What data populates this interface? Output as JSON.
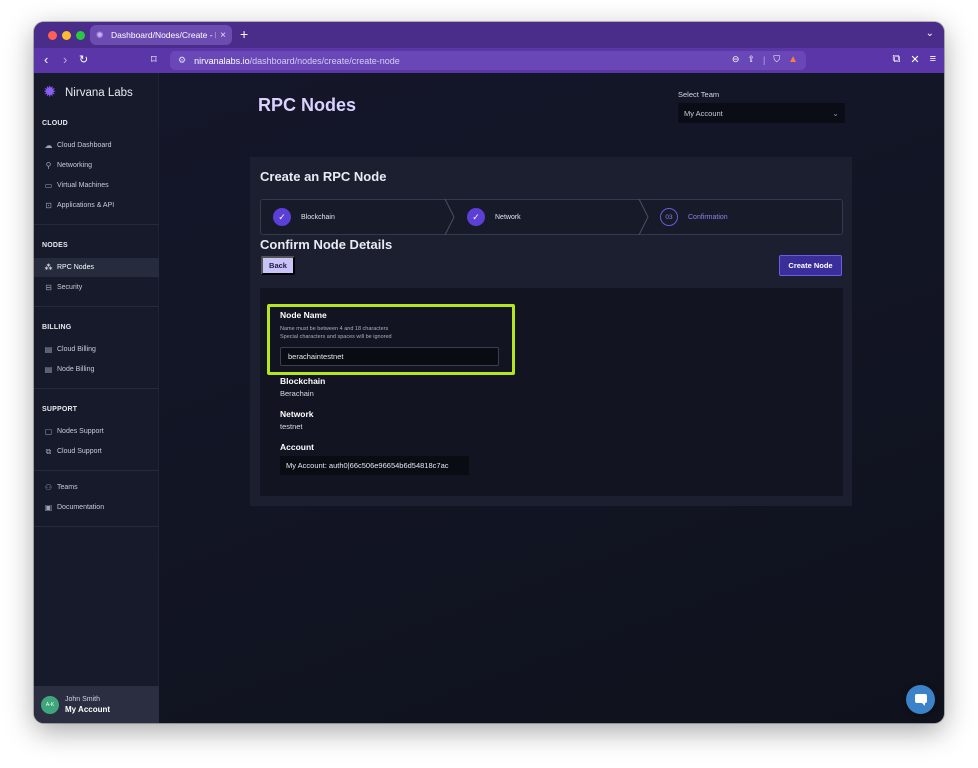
{
  "browser": {
    "tab_title": "Dashboard/Nodes/Create - N",
    "tab_close": "×",
    "new_tab": "+",
    "url_host": "nirvanalabs.io",
    "url_path": "/dashboard/nodes/create/create-node",
    "icons": [
      "back-icon",
      "forward-icon",
      "reload-icon",
      "bookmark-icon",
      "zoom-icon",
      "share-icon",
      "brave-shield-icon",
      "brave-rewards-icon",
      "extensions-icon",
      "menu-icon"
    ]
  },
  "sidebar": {
    "brand": "Nirvana Labs",
    "sections": {
      "cloud": "CLOUD",
      "nodes": "NODES",
      "billing": "BILLING",
      "support": "SUPPORT"
    },
    "items": {
      "cloud_dashboard": "Cloud Dashboard",
      "networking": "Networking",
      "virtual_machines": "Virtual Machines",
      "applications_api": "Applications & API",
      "rpc_nodes": "RPC Nodes",
      "security": "Security",
      "cloud_billing": "Cloud Billing",
      "node_billing": "Node Billing",
      "nodes_support": "Nodes Support",
      "cloud_support": "Cloud Support",
      "teams": "Teams",
      "documentation": "Documentation"
    },
    "user": {
      "initials": "A-K",
      "name": "John Smith",
      "account": "My Account"
    }
  },
  "header": {
    "title": "RPC Nodes",
    "team_label": "Select Team",
    "team_value": "My Account"
  },
  "create": {
    "title": "Create an RPC Node",
    "steps": [
      {
        "label": "Blockchain",
        "state": "done"
      },
      {
        "label": "Network",
        "state": "done"
      },
      {
        "number": "03",
        "label": "Confirmation",
        "state": "current"
      }
    ],
    "confirm_title": "Confirm Node Details",
    "back_label": "Back",
    "create_label": "Create Node",
    "node_name_label": "Node Name",
    "node_name_hint_1": "Name must be between 4 and 18 characters",
    "node_name_hint_2": "Special characters and spaces will be ignored",
    "node_name_value": "berachaintestnet",
    "blockchain_label": "Blockchain",
    "blockchain_value": "Berachain",
    "network_label": "Network",
    "network_value": "testnet",
    "account_label": "Account",
    "account_value": "My Account: auth0|66c506e96654b6d54818c7ac"
  },
  "colors": {
    "accent": "#5b3fd6",
    "highlight": "#b5e61d",
    "chrome": "#5a36a8"
  }
}
